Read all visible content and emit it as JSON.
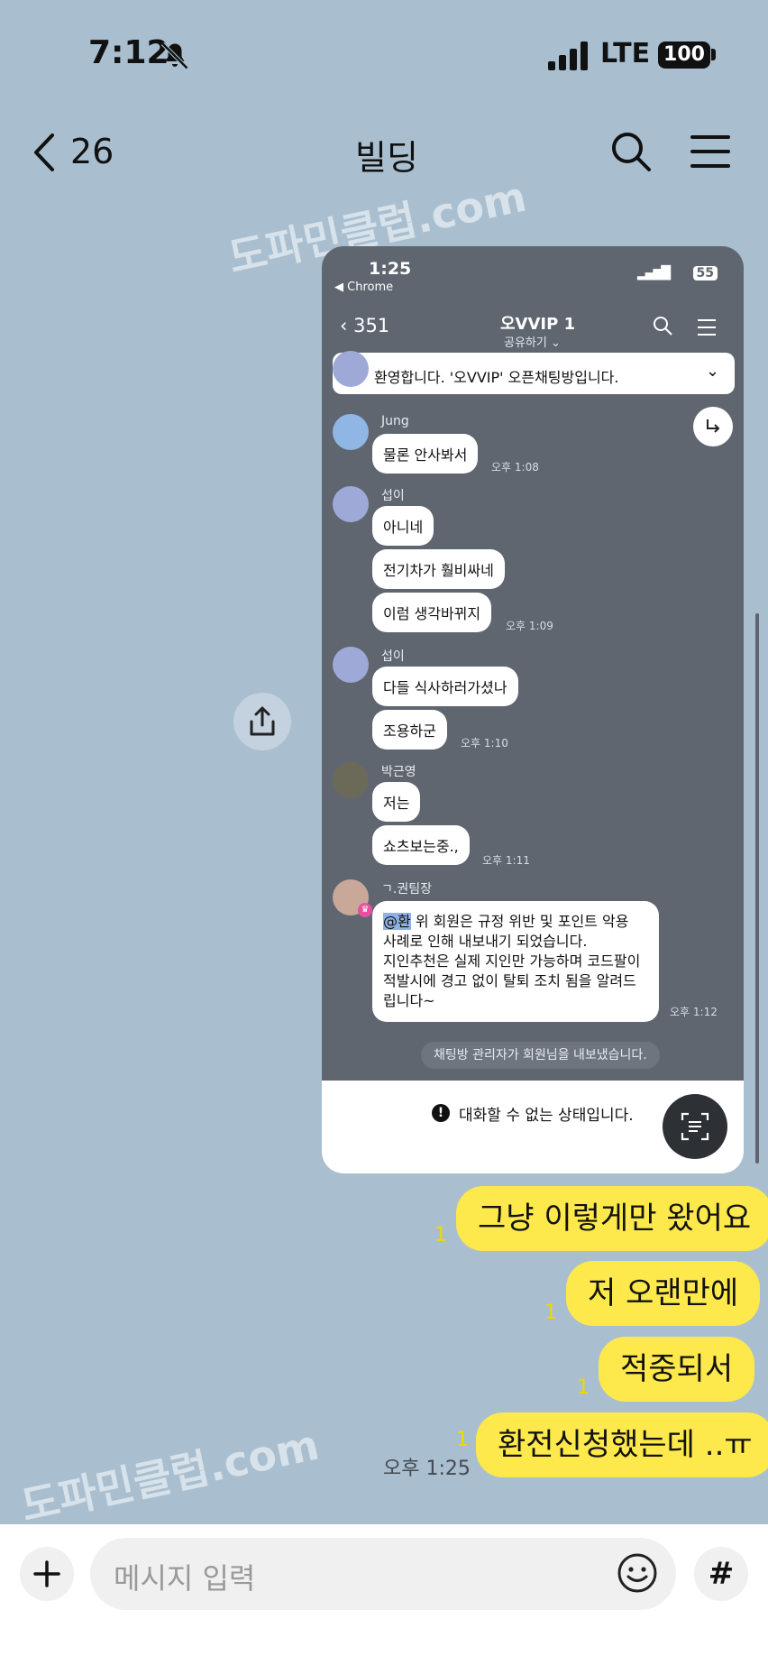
{
  "status_bar": {
    "time": "7:12",
    "network": "LTE",
    "battery": "100",
    "icons": [
      "bell-slash-icon",
      "signal-icon",
      "battery-icon"
    ]
  },
  "header": {
    "back_count": "26",
    "title": "빌딩",
    "icons": [
      "chevron-left-icon",
      "search-icon",
      "menu-icon"
    ]
  },
  "watermark": "도파민클럽.com",
  "embedded_screenshot": {
    "status": {
      "time": "1:25",
      "back_app": "◀ Chrome",
      "battery": "55"
    },
    "header": {
      "back_count": "351",
      "title": "오VVIP 1",
      "subtitle": "공유하기"
    },
    "notice": "환영합니다. '오VVIP' 오픈채팅방입니다.",
    "messages": [
      {
        "sender": "Jung",
        "bubbles": [
          "물론 안사봐서"
        ],
        "time": "오후 1:08"
      },
      {
        "sender": "섭이",
        "bubbles": [
          "아니네",
          "전기차가 훨비싸네",
          "이럼 생각바뀌지"
        ],
        "time": "오후 1:09"
      },
      {
        "sender": "섭이",
        "bubbles": [
          "다들 식사하러가셨나",
          "조용하군"
        ],
        "time": "오후 1:10"
      },
      {
        "sender": "박근영",
        "bubbles": [
          "저는",
          "쇼츠보는중.,"
        ],
        "time": "오후 1:11"
      }
    ],
    "admin_message": {
      "sender": "ㄱ.권팀장",
      "mention": "@환",
      "lines": [
        "위 회원은 규정 위반 및 포인트 악용",
        "사례로 인해 내보내기 되었습니다.",
        "지인추천은 실제 지인만 가능하며 코드팔이",
        "적발시에 경고 없이 탈퇴 조치 됨을 알려드",
        "립니다~"
      ],
      "time": "오후 1:12"
    },
    "system_message": "채팅방 관리자가 회원님을 내보냈습니다.",
    "bottom_notice": "대화할 수 없는 상태입니다."
  },
  "my_messages": [
    {
      "text": "그냥 이렇게만 왔어요",
      "unread": "1"
    },
    {
      "text": "저 오랜만에",
      "unread": "1"
    },
    {
      "text": "적중되서",
      "unread": "1"
    },
    {
      "text": "환전신청했는데 ..ㅠ",
      "unread": "1"
    }
  ],
  "last_time": "오후 1:25",
  "input": {
    "placeholder": "메시지 입력",
    "icons": [
      "plus-icon",
      "emoji-icon",
      "hashtag-icon"
    ]
  },
  "colors": {
    "background": "#a9bfd0",
    "my_bubble": "#fde94b",
    "embedded_bg": "#5f6670"
  }
}
